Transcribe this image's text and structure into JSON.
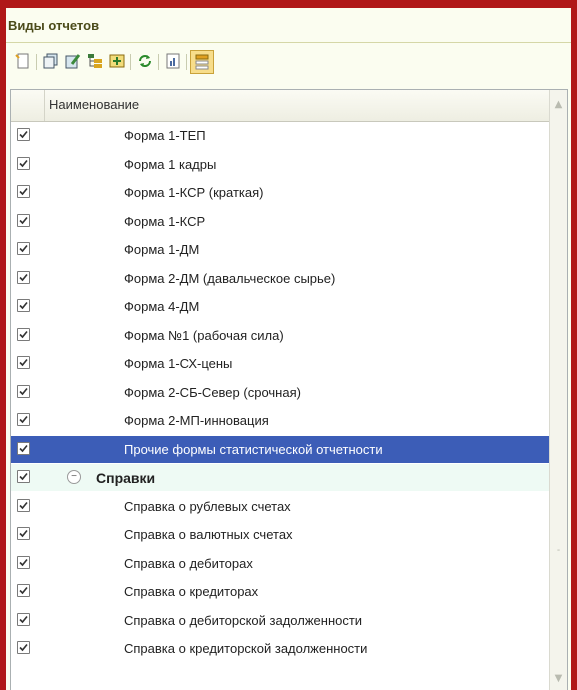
{
  "panel": {
    "title": "Виды отчетов"
  },
  "toolbar": {
    "buttons": [
      "new-icon",
      "copy-icon",
      "edit-icon",
      "hierarchy-icon",
      "add-group-icon",
      "refresh-icon",
      "report-icon",
      "list-mode-icon"
    ]
  },
  "grid": {
    "column_header": "Наименование",
    "rows": [
      {
        "label": "Форма 1-ТЕП",
        "checked": true,
        "type": "child"
      },
      {
        "label": "Форма 1 кадры",
        "checked": true,
        "type": "child"
      },
      {
        "label": "Форма 1-КСР (краткая)",
        "checked": true,
        "type": "child"
      },
      {
        "label": "Форма 1-КСР",
        "checked": true,
        "type": "child"
      },
      {
        "label": "Форма 1-ДМ",
        "checked": true,
        "type": "child"
      },
      {
        "label": "Форма 2-ДМ (давальческое сырье)",
        "checked": true,
        "type": "child"
      },
      {
        "label": "Форма 4-ДМ",
        "checked": true,
        "type": "child"
      },
      {
        "label": "Форма №1 (рабочая сила)",
        "checked": true,
        "type": "child"
      },
      {
        "label": "Форма 1-СХ-цены",
        "checked": true,
        "type": "child"
      },
      {
        "label": "Форма 2-СБ-Север (срочная)",
        "checked": true,
        "type": "child"
      },
      {
        "label": "Форма 2-МП-инновация",
        "checked": true,
        "type": "child"
      },
      {
        "label": "Прочие формы статистической отчетности",
        "checked": true,
        "type": "selected"
      },
      {
        "label": "Справки",
        "checked": true,
        "type": "group"
      },
      {
        "label": "Справка о рублевых счетах",
        "checked": true,
        "type": "child"
      },
      {
        "label": "Справка о валютных счетах",
        "checked": true,
        "type": "child"
      },
      {
        "label": "Справка о дебиторах",
        "checked": true,
        "type": "child"
      },
      {
        "label": "Справка о кредиторах",
        "checked": true,
        "type": "child"
      },
      {
        "label": "Справка о дебиторской задолженности",
        "checked": true,
        "type": "child"
      },
      {
        "label": "Справка о кредиторской задолженности",
        "checked": true,
        "type": "child"
      }
    ]
  }
}
